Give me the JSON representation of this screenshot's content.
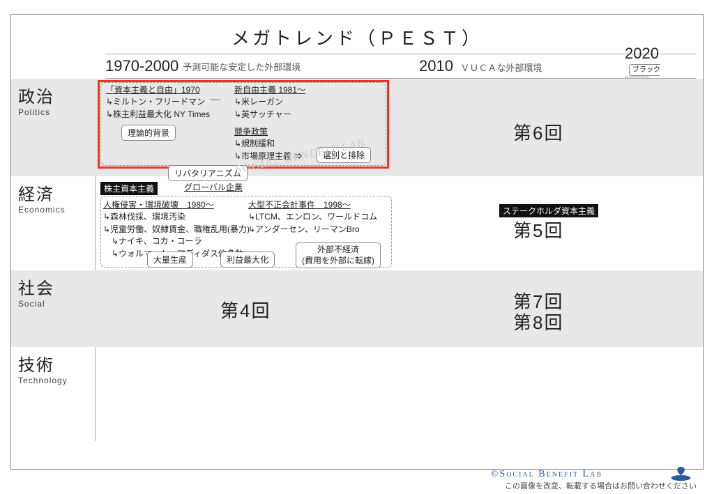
{
  "title": "メガトレンド（ＰＥＳＴ）",
  "timeline": {
    "era1": {
      "year": "1970-2000",
      "sub": "予測可能な安定した外部環境"
    },
    "era2": {
      "year": "2010",
      "sub": "ＶＵＣＡな外部環境"
    },
    "era3": {
      "year": "2020",
      "badge": "ブラック\nスワン"
    }
  },
  "rows": {
    "politics": {
      "jp": "政治",
      "en": "Politics"
    },
    "economics": {
      "jp": "経済",
      "en": "Economics"
    },
    "social": {
      "jp": "社会",
      "en": "Social"
    },
    "technology": {
      "jp": "技術",
      "en": "Technology"
    }
  },
  "politics": {
    "a1": "「資本主義と自由」1970",
    "a2": "↳ミルトン・フリードマン",
    "a3": "↳株主利益最大化 NY Times",
    "b1": "新自由主義 1981～",
    "b2": "↳米レーガン",
    "b3": "↳英サッチャー",
    "chip1": "理論的背景",
    "c1": "競争政策",
    "c2": "↳規制緩和",
    "c3": "↳市場原理主義 ⇒",
    "chip2": "選別と排除",
    "chip3": "リバタリアニズム"
  },
  "economics": {
    "blk1": "株主資本主義",
    "u1": "グローバル企業",
    "d1": "人権侵害・環境破壊　1980～",
    "d2": "↳森林伐採、環境汚染",
    "d3": "↳児童労働、奴隷賃金、職権乱用(暴力)",
    "d4": "　↳ナイキ、コカ・コーラ",
    "d5": "　↳ウォルマート、アディダス他多数",
    "e1": "大型不正会計事件　1998～",
    "e2": "↳LTCM、エンロン、ワールドコム",
    "e3": "↳アンダーセン、リーマンBro",
    "chip4": "大量生産",
    "chip5": "利益最大化",
    "chip6a": "外部不経済",
    "chip6b": "(費用を外部に転嫁)",
    "blk2": "ステークホルダ資本主義"
  },
  "sessions": {
    "s4": "第4回",
    "s5": "第5回",
    "s6": "第6回",
    "s7": "第7回",
    "s8": "第8回"
  },
  "watermark": "SOCIAL BENEFIT LAB",
  "footer": {
    "copyright": "©Social Benefit Lab",
    "note": "この画像を改変、転載する場合はお問い合わせください"
  }
}
